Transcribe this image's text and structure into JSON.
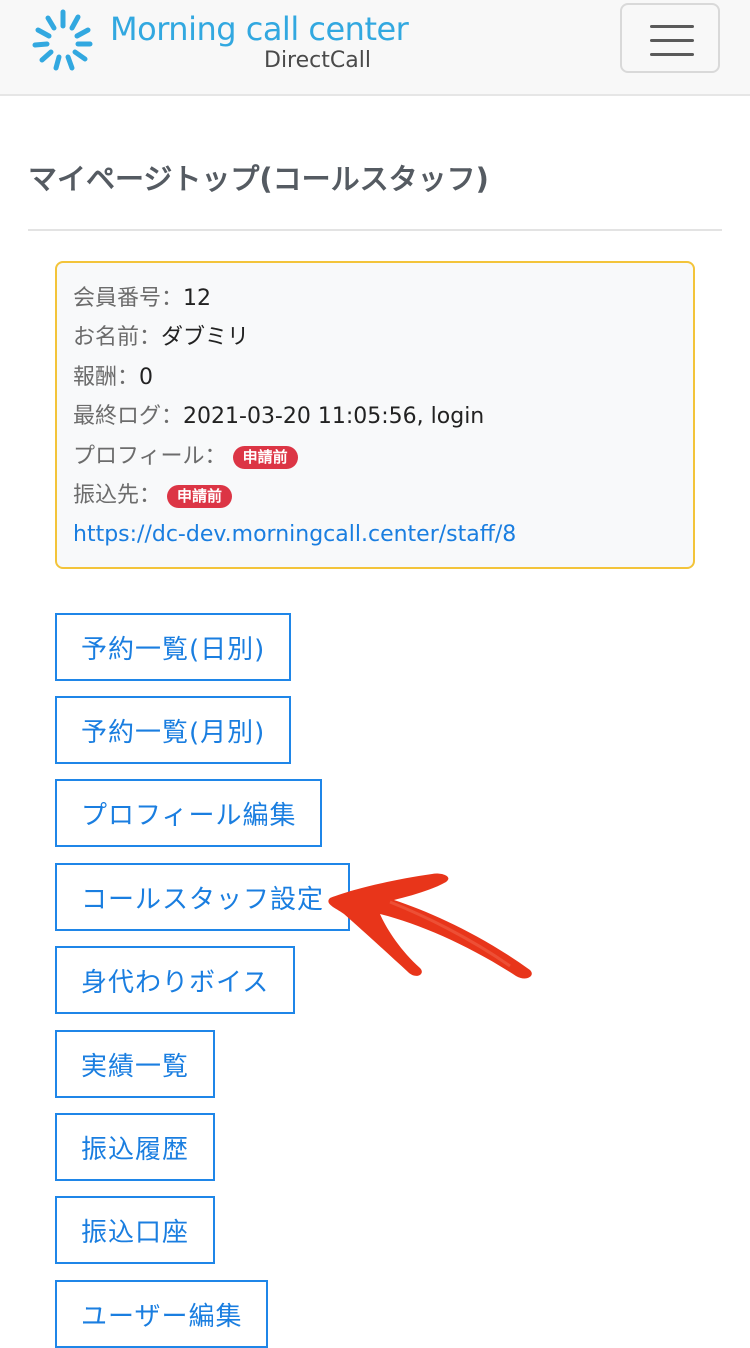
{
  "header": {
    "brand_title": "Morning call center",
    "brand_sub": "DirectCall",
    "logo_icon": "sunburst-logo-icon",
    "menu_icon": "hamburger-menu-icon"
  },
  "page": {
    "title": "マイページトップ(コールスタッフ)"
  },
  "info": {
    "member_no_label": "会員番号：",
    "member_no": "12",
    "name_label": "お名前：",
    "name": "ダブミリ",
    "reward_label": "報酬：",
    "reward": "0",
    "last_log_label": "最終ログ：",
    "last_log": "2021-03-20 11:05:56, login",
    "profile_label": "プロフィール：",
    "profile_status": "申請前",
    "bank_label": "振込先：",
    "bank_status": "申請前",
    "url": "https://dc-dev.morningcall.center/staff/8"
  },
  "menu": [
    {
      "label": "予約一覧(日別)"
    },
    {
      "label": "予約一覧(月別)"
    },
    {
      "label": "プロフィール編集"
    },
    {
      "label": "コールスタッフ設定"
    },
    {
      "label": "身代わりボイス"
    },
    {
      "label": "実績一覧"
    },
    {
      "label": "振込履歴"
    },
    {
      "label": "振込口座"
    },
    {
      "label": "ユーザー編集"
    }
  ],
  "colors": {
    "brand": "#32a8e0",
    "primary": "#1a7ee0",
    "danger": "#dc3545",
    "warning_border": "#f3c43a",
    "annotation": "#e8351a"
  }
}
